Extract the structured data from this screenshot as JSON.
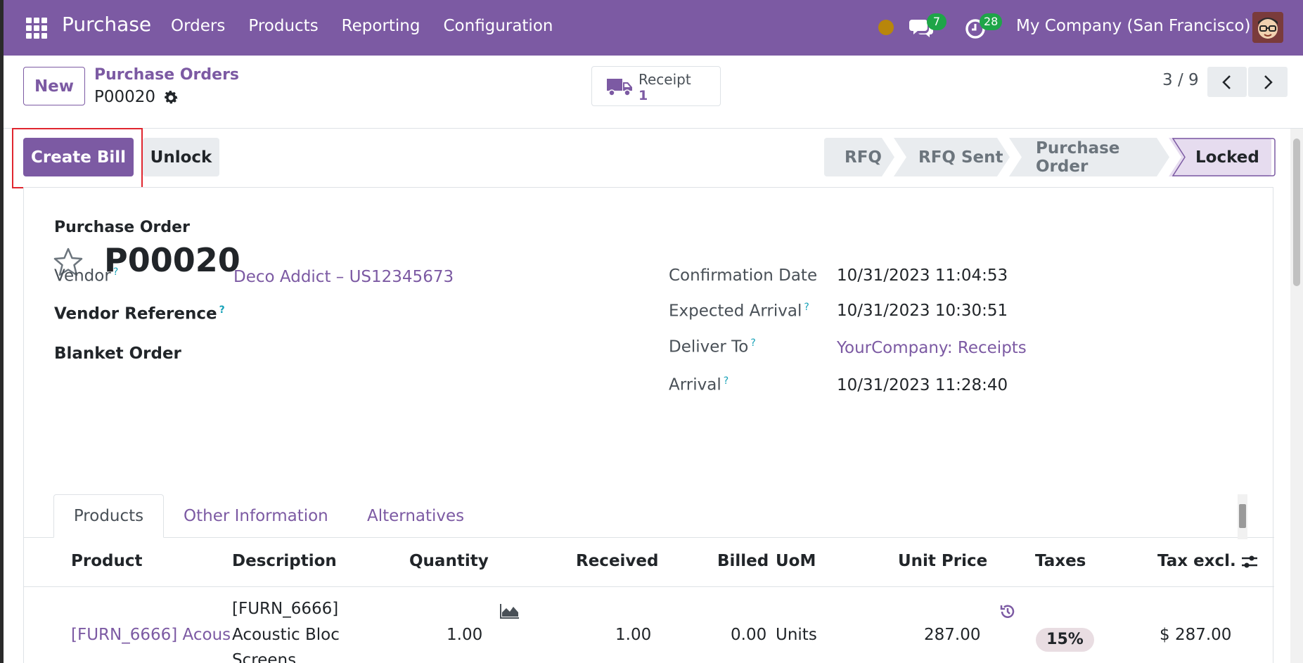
{
  "navbar": {
    "app_name": "Purchase",
    "menu": [
      "Orders",
      "Products",
      "Reporting",
      "Configuration"
    ],
    "messages_count": "7",
    "activities_count": "28",
    "company": "My Company (San Francisco)",
    "brand_color": "#7c5aa3"
  },
  "control_panel": {
    "new_label": "New",
    "breadcrumb": "Purchase Orders",
    "record_name": "P00020",
    "receipt_label": "Receipt",
    "receipt_count": "1",
    "pager": "3 / 9"
  },
  "statusbar": {
    "create_bill_label": "Create Bill",
    "unlock_label": "Unlock",
    "stages": [
      "RFQ",
      "RFQ Sent",
      "Purchase Order",
      "Locked"
    ],
    "current_stage": "Locked",
    "highlight_color": "#e0262f"
  },
  "form": {
    "record_type": "Purchase Order",
    "title": "P00020",
    "vendor_label": "Vendor",
    "vendor_value": "Deco Addict – US12345673",
    "vendor_reference_label": "Vendor Reference",
    "blanket_order_label": "Blanket Order",
    "confirmation_date_label": "Confirmation Date",
    "confirmation_date_value": "10/31/2023 11:04:53",
    "expected_arrival_label": "Expected Arrival",
    "expected_arrival_value": "10/31/2023 10:30:51",
    "deliver_to_label": "Deliver To",
    "deliver_to_value": "YourCompany: Receipts",
    "arrival_label": "Arrival",
    "arrival_value": "10/31/2023 11:28:40",
    "help_mark": "?"
  },
  "tabs": [
    "Products",
    "Other Information",
    "Alternatives"
  ],
  "table": {
    "columns": [
      "Product",
      "Description",
      "Quantity",
      "Received",
      "Billed",
      "UoM",
      "Unit Price",
      "Taxes",
      "Tax excl."
    ],
    "rows": [
      {
        "product": "[FURN_6666] Acous",
        "description_lines": [
          "[FURN_6666]",
          "Acoustic Bloc",
          "Screens"
        ],
        "quantity": "1.00",
        "received": "1.00",
        "billed": "0.00",
        "uom": "Units",
        "unit_price": "287.00",
        "taxes": "15%",
        "tax_excl": "$ 287.00"
      }
    ]
  }
}
